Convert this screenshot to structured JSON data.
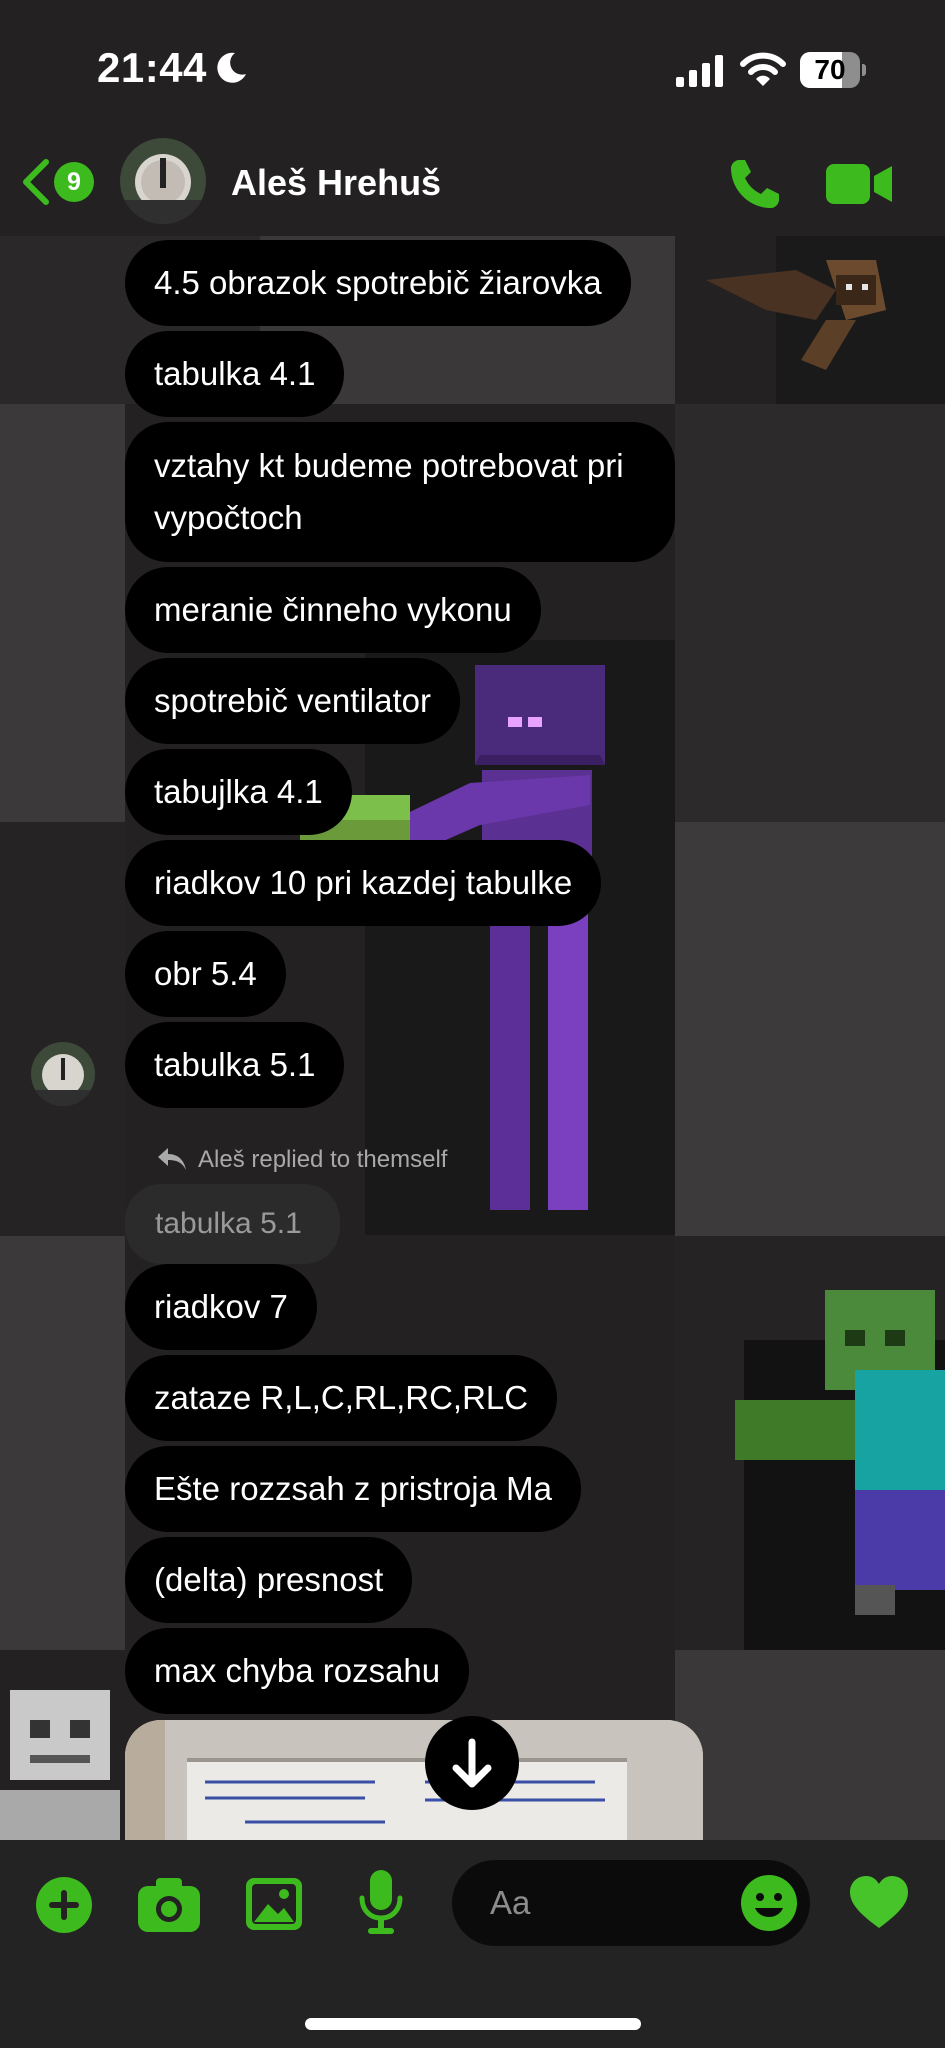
{
  "status_bar": {
    "time": "21:44",
    "battery": "70",
    "battery_level": 0.7
  },
  "header": {
    "back_badge": "9",
    "contact_name": "Aleš Hrehuš"
  },
  "messages": [
    "4.5 obrazok spotrebič žiarovka",
    "tabulka 4.1",
    "vztahy kt budeme potrebovat pri vypočtoch",
    "meranie činneho vykonu",
    "spotrebič ventilator",
    "tabujlka 4.1",
    "riadkov 10 pri kazdej tabulke",
    "obr 5.4",
    "tabulka 5.1"
  ],
  "reply": {
    "note": "Aleš replied to themself",
    "quoted": "tabulka 5.1"
  },
  "messages_after": [
    "riadkov 7",
    "zataze R,L,C,RL,RC,RLC",
    "Ešte rozzsah z pristroja Ma",
    "(delta) presnost",
    "max chyba rozsahu"
  ],
  "composer": {
    "placeholder": "Aa"
  },
  "colors": {
    "accent": "#3dbb1e",
    "bubble": "#000000",
    "background": "#232122"
  },
  "icons": [
    "moon-icon",
    "signal-icon",
    "wifi-icon",
    "battery-icon",
    "back-chevron-icon",
    "phone-icon",
    "video-icon",
    "reply-arrow-icon",
    "arrow-down-icon",
    "plus-icon",
    "camera-icon",
    "image-icon",
    "microphone-icon",
    "smiley-icon",
    "heart-icon"
  ]
}
